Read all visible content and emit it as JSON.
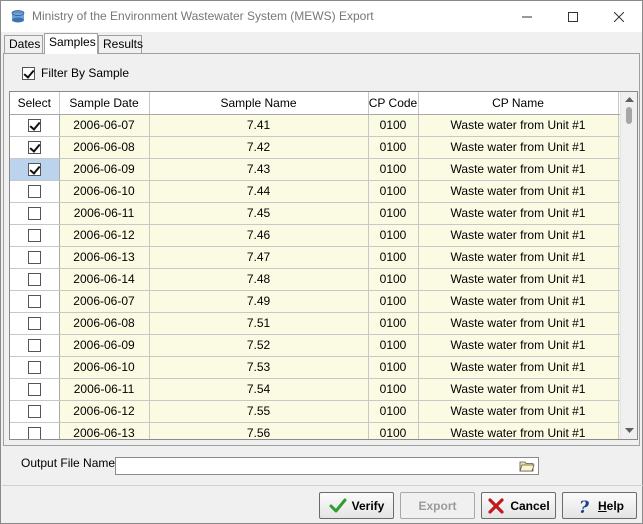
{
  "window": {
    "title": "Ministry of the Environment Wastewater System (MEWS) Export"
  },
  "tabs": [
    {
      "label": "Dates",
      "active": false
    },
    {
      "label": "Samples",
      "active": true
    },
    {
      "label": "Results",
      "active": false
    }
  ],
  "filter": {
    "label": "Filter By Sample",
    "checked": true
  },
  "grid": {
    "columns": [
      "Select",
      "Sample Date",
      "Sample Name",
      "CP Code",
      "CP Name"
    ],
    "rows": [
      {
        "selected": true,
        "date": "2006-06-07",
        "name": "7.41",
        "cp_code": "0100",
        "cp_name": "Waste water from Unit #1"
      },
      {
        "selected": true,
        "date": "2006-06-08",
        "name": "7.42",
        "cp_code": "0100",
        "cp_name": "Waste water from Unit #1"
      },
      {
        "selected": true,
        "date": "2006-06-09",
        "name": "7.43",
        "cp_code": "0100",
        "cp_name": "Waste water from Unit #1"
      },
      {
        "selected": false,
        "date": "2006-06-10",
        "name": "7.44",
        "cp_code": "0100",
        "cp_name": "Waste water from Unit #1"
      },
      {
        "selected": false,
        "date": "2006-06-11",
        "name": "7.45",
        "cp_code": "0100",
        "cp_name": "Waste water from Unit #1"
      },
      {
        "selected": false,
        "date": "2006-06-12",
        "name": "7.46",
        "cp_code": "0100",
        "cp_name": "Waste water from Unit #1"
      },
      {
        "selected": false,
        "date": "2006-06-13",
        "name": "7.47",
        "cp_code": "0100",
        "cp_name": "Waste water from Unit #1"
      },
      {
        "selected": false,
        "date": "2006-06-14",
        "name": "7.48",
        "cp_code": "0100",
        "cp_name": "Waste water from Unit #1"
      },
      {
        "selected": false,
        "date": "2006-06-07",
        "name": "7.49",
        "cp_code": "0100",
        "cp_name": "Waste water from Unit #1"
      },
      {
        "selected": false,
        "date": "2006-06-08",
        "name": "7.51",
        "cp_code": "0100",
        "cp_name": "Waste water from Unit #1"
      },
      {
        "selected": false,
        "date": "2006-06-09",
        "name": "7.52",
        "cp_code": "0100",
        "cp_name": "Waste water from Unit #1"
      },
      {
        "selected": false,
        "date": "2006-06-10",
        "name": "7.53",
        "cp_code": "0100",
        "cp_name": "Waste water from Unit #1"
      },
      {
        "selected": false,
        "date": "2006-06-11",
        "name": "7.54",
        "cp_code": "0100",
        "cp_name": "Waste water from Unit #1"
      },
      {
        "selected": false,
        "date": "2006-06-12",
        "name": "7.55",
        "cp_code": "0100",
        "cp_name": "Waste water from Unit #1"
      },
      {
        "selected": false,
        "date": "2006-06-13",
        "name": "7.56",
        "cp_code": "0100",
        "cp_name": "Waste water from Unit #1"
      }
    ],
    "highlighted_row": 2
  },
  "output": {
    "label": "Output File Name:",
    "value": "",
    "browse_icon": "folder-browse-icon"
  },
  "buttons": {
    "verify": "Verify",
    "export": "Export",
    "cancel": "Cancel",
    "help_prefix": "H",
    "help_rest": "elp"
  },
  "colors": {
    "row_bg": "#fbfbe3",
    "highlight": "#bcd3ee",
    "verify_icon": "#2e9e2e",
    "cancel_icon": "#c0191f",
    "help_icon": "#1b3f8f"
  }
}
